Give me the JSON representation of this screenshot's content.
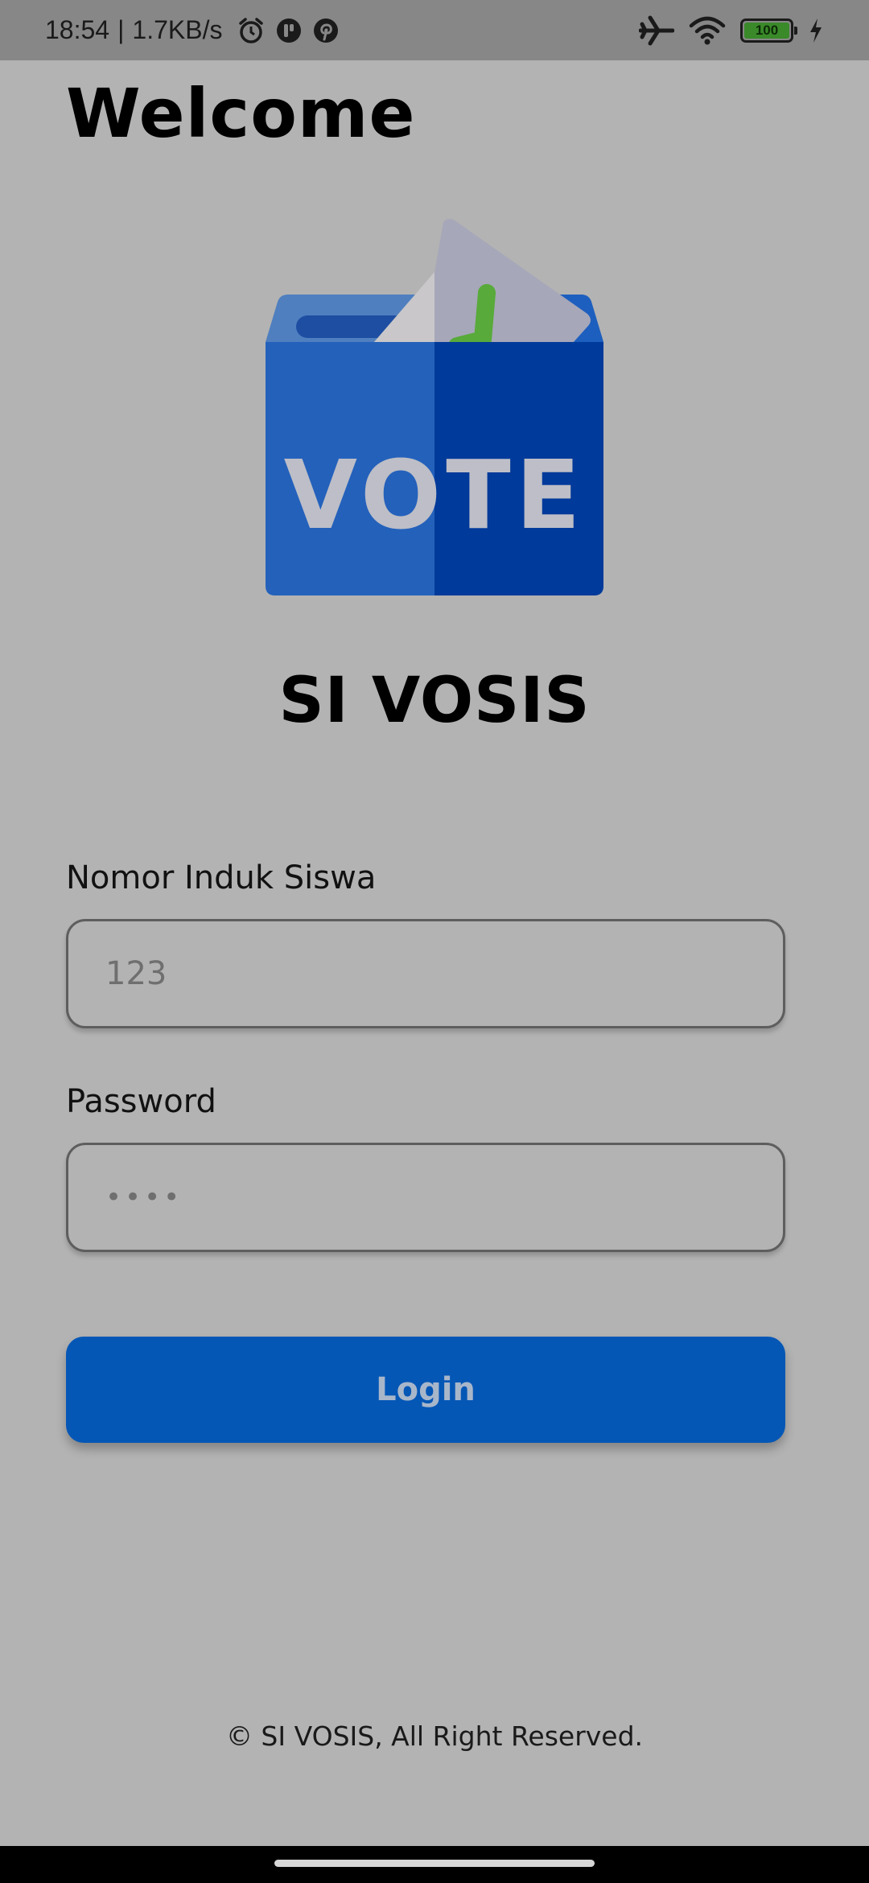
{
  "status_bar": {
    "time": "18:54",
    "separator": "|",
    "speed": "1.7KB/s",
    "battery_level": "100",
    "icons_left": [
      "alarm-icon",
      "app-icon",
      "pinterest-icon"
    ],
    "icons_right": [
      "airplane-icon",
      "wifi-icon",
      "battery-icon",
      "charging-icon"
    ]
  },
  "header": {
    "title": "Welcome"
  },
  "logo": {
    "text": "VOTE",
    "icon": "ballot-box-icon"
  },
  "app": {
    "name": "SI VOSIS"
  },
  "form": {
    "nis_label": "Nomor Induk Siswa",
    "nis_value": "123",
    "password_label": "Password",
    "password_value": "••••",
    "login_label": "Login"
  },
  "footer": {
    "text": "© SI VOSIS, All Right Reserved."
  },
  "colors": {
    "background": "#b3b3b3",
    "accent": "#0557b6",
    "status_bar": "#878787"
  }
}
